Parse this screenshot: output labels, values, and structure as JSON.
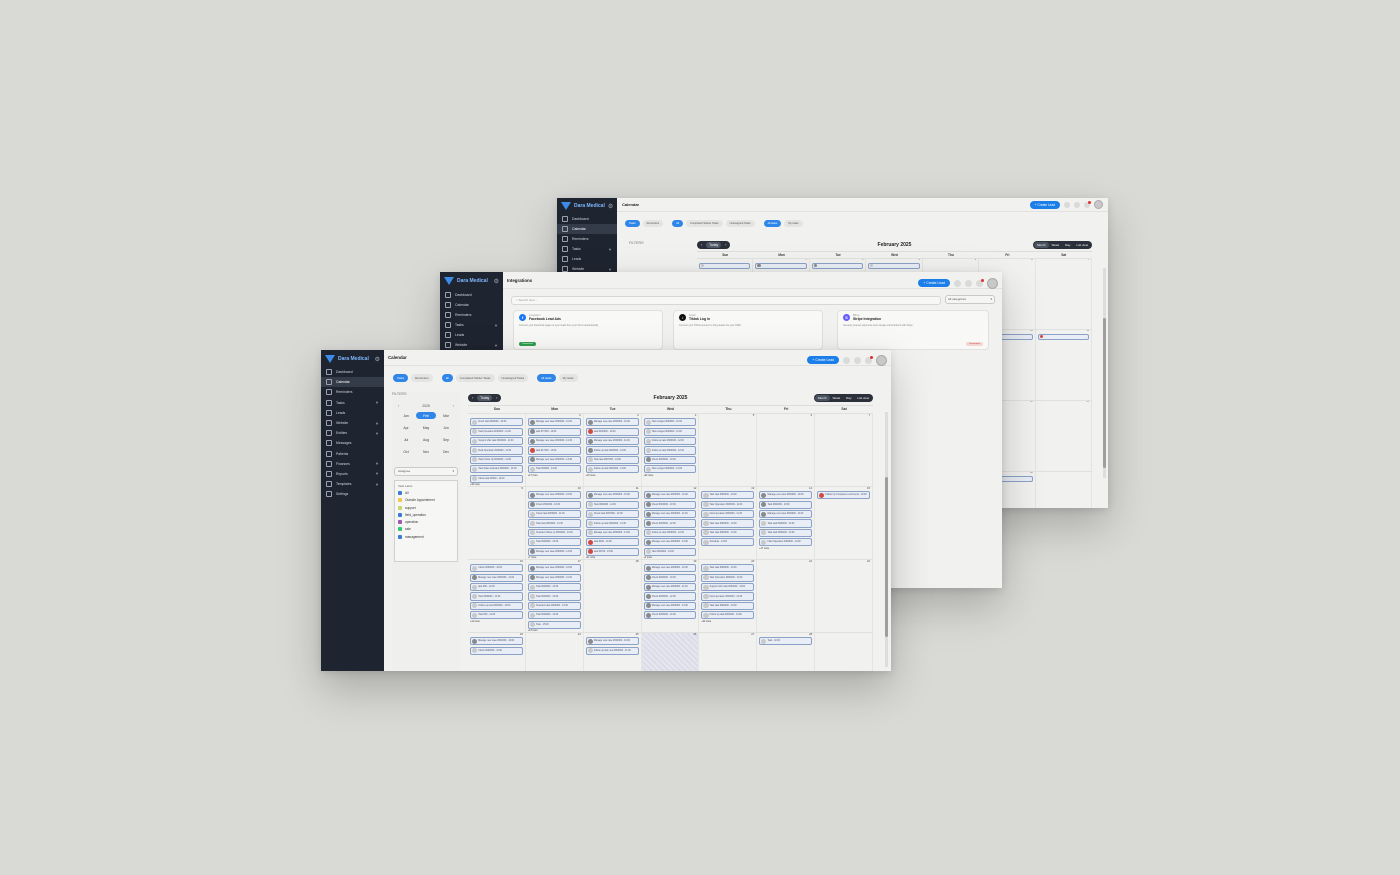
{
  "brand": "Dara Medical",
  "nav": [
    "Dashboard",
    "Calendar",
    "Reminders",
    "Tasks",
    "Leads",
    "Website",
    "Entities",
    "Messages",
    "Patients",
    "Finances",
    "Reports",
    "Templates",
    "Settings"
  ],
  "calendar_page": {
    "title": "Calendar",
    "create_label": "+ Create Lead",
    "chips": [
      "Tasks",
      "Reminders",
      "All",
      "Completed Sticker Tasks",
      "Unassigned Tasks",
      "All tasks",
      "My tasks"
    ],
    "filters_label": "FILTERS",
    "today_label": "Today",
    "month_title": "February 2025",
    "views": [
      "Month",
      "Week",
      "Day",
      "List view"
    ],
    "day_headers": [
      "Sun",
      "Mon",
      "Tue",
      "Wed",
      "Thu",
      "Fri",
      "Sat"
    ],
    "year": "2025",
    "months": [
      "Jan",
      "Feb",
      "Mar",
      "Apr",
      "May",
      "Jun",
      "Jul",
      "Aug",
      "Sep",
      "Oct",
      "Nov",
      "Dec"
    ],
    "assignee_label": "Assignee",
    "task_label_title": "Task Label",
    "task_labels": [
      {
        "name": "All",
        "color": "#3a7bd5"
      },
      {
        "name": "Outside Appointment",
        "color": "#f2c94c"
      },
      {
        "name": "support",
        "color": "#c9d36a"
      },
      {
        "name": "field_operation",
        "color": "#3a7bd5"
      },
      {
        "name": "operation",
        "color": "#9b59b6"
      },
      {
        "name": "sale",
        "color": "#2ecc71"
      },
      {
        "name": "management",
        "color": "#3a7bd5"
      }
    ],
    "weeks": [
      {
        "days": [
          {
            "num": "",
            "events": [
              {
                "t": "Fresh task #000000 - 10:00",
                "a": 0
              },
              {
                "t": "Task Operation #000000 - 11:00",
                "a": 0
              },
              {
                "t": "Support offer task #000000 - 11:30",
                "a": 0
              },
              {
                "t": "Field Operation #000000 - 11:30",
                "a": 0
              },
              {
                "t": "Task Follow Up #000000 - 11:30",
                "a": 0
              },
              {
                "t": "Task Sales Assistant #000000 - 12:00",
                "a": 0
              },
              {
                "t": "Check task #0000 - 12:00",
                "a": 0
              }
            ],
            "more": "+16 more"
          },
          {
            "num": "2",
            "events": [
              {
                "t": "Manage new case #000000 - 11:00",
                "a": 1
              },
              {
                "t": "task #77000 - 12:00",
                "a": 1
              },
              {
                "t": "Manage new case #000000 - 12:30",
                "a": 1
              },
              {
                "t": "task #17000 - 13:00",
                "a": 3
              },
              {
                "t": "Manage new case #000000 - 13:30",
                "a": 1
              },
              {
                "t": "Task #00000 - 14:00",
                "a": 0
              }
            ],
            "more": "+17 more"
          },
          {
            "num": "3",
            "events": [
              {
                "t": "Manage new case #000000 - 10:00",
                "a": 1
              },
              {
                "t": "task #000000 - 10:30",
                "a": 3
              },
              {
                "t": "Manage new case #000000 - 11:00",
                "a": 1
              },
              {
                "t": "Follow up task #000000 - 12:00",
                "a": 1
              },
              {
                "t": "Task task #007000 - 13:00",
                "a": 0
              },
              {
                "t": "Follow up task #000000 - 14:00",
                "a": 0
              }
            ],
            "more": "+15 more"
          },
          {
            "num": "4",
            "events": [
              {
                "t": "Task Lodges #000000 - 10:00",
                "a": 0
              },
              {
                "t": "Task Lodges #000000 - 11:00",
                "a": 0
              },
              {
                "t": "Follow up task #000000 - 12:00",
                "a": 0
              },
              {
                "t": "Follow up task #000000 - 12:30",
                "a": 0
              },
              {
                "t": "Check #000000 - 13:00",
                "a": 1
              },
              {
                "t": "Task Lodges #000000 - 14:00",
                "a": 0
              }
            ],
            "more": "+22 more"
          },
          {
            "num": "5",
            "events": [],
            "more": ""
          },
          {
            "num": "6",
            "events": [],
            "more": ""
          },
          {
            "num": "7",
            "events": [],
            "more": ""
          }
        ]
      },
      {
        "days": [
          {
            "num": "9",
            "events": [],
            "more": ""
          },
          {
            "num": "10",
            "events": [
              {
                "t": "Manage new case #000000 - 10:00",
                "a": 1
              },
              {
                "t": "Check #000000 - 10:30",
                "a": 1
              },
              {
                "t": "Check task #000000 - 11:00",
                "a": 0
              },
              {
                "t": "Task task #000000 - 11:30",
                "a": 0
              },
              {
                "t": "Sussdent follow up #000000 - 12:00",
                "a": 0
              },
              {
                "t": "Task #000000 - 13:00",
                "a": 0
              },
              {
                "t": "Manage new case #000000 - 14:00",
                "a": 1
              }
            ],
            "more": "+7 more"
          },
          {
            "num": "11",
            "events": [
              {
                "t": "Manage new case #000000 - 10:00",
                "a": 1
              },
              {
                "t": "Task #000000 - 11:00",
                "a": 0
              },
              {
                "t": "Check task #007000 - 12:00",
                "a": 0
              },
              {
                "t": "Follow up task #000000 - 12:30",
                "a": 0
              },
              {
                "t": "Manage new case #000000 - 13:00",
                "a": 0
              },
              {
                "t": "task #000 - 14:00",
                "a": 3
              },
              {
                "t": "task #0700 - 15:00",
                "a": 3
              }
            ],
            "more": "+11 more"
          },
          {
            "num": "12",
            "events": [
              {
                "t": "Manage new case #000000 - 10:00",
                "a": 1
              },
              {
                "t": "Check #000000 - 10:30",
                "a": 1
              },
              {
                "t": "Manage new case #000000 - 11:00",
                "a": 1
              },
              {
                "t": "Check #000000 - 12:00",
                "a": 1
              },
              {
                "t": "Follow up task #000000 - 12:30",
                "a": 0
              },
              {
                "t": "Manage new case #000000 - 13:00",
                "a": 1
              },
              {
                "t": "Task #000000 - 14:00",
                "a": 0
              }
            ],
            "more": "+2 more"
          },
          {
            "num": "13",
            "events": [
              {
                "t": "Task task #000000 - 10:00",
                "a": 0
              },
              {
                "t": "Task Operation #000000 - 11:00",
                "a": 0
              },
              {
                "t": "Field operation #000000 - 11:30",
                "a": 0
              },
              {
                "t": "Task task #000000 - 12:00",
                "a": 0
              },
              {
                "t": "Task task #000000 - 13:00",
                "a": 0
              },
              {
                "t": "Schedule - 14:00",
                "a": 0
              }
            ],
            "more": ""
          },
          {
            "num": "14",
            "events": [
              {
                "t": "Manage new case #000000 - 10:00",
                "a": 1
              },
              {
                "t": "Task #000000 - 10:30",
                "a": 1
              },
              {
                "t": "Manage new case #000000 - 11:00",
                "a": 1
              },
              {
                "t": "Task task #000000 - 12:00",
                "a": 0
              },
              {
                "t": "Task task #000000 - 13:00",
                "a": 0
              },
              {
                "t": "Field Operation #000000 - 14:00",
                "a": 0
              }
            ],
            "more": "+17 more"
          },
          {
            "num": "15",
            "events": [
              {
                "t": "Follow Up Complete recommend - 10:00",
                "a": 3
              }
            ],
            "more": ""
          }
        ]
      },
      {
        "days": [
          {
            "num": "16",
            "events": [
              {
                "t": "Check #000000 - 10:00",
                "a": 0
              },
              {
                "t": "Manage new case #000000 - 11:00",
                "a": 1
              },
              {
                "t": "task #00 - 12:00",
                "a": 0
              },
              {
                "t": "Task #000000 - 12:30",
                "a": 0
              },
              {
                "t": "Follow up task #000000 - 13:00",
                "a": 0
              },
              {
                "t": "Task #00 - 14:00",
                "a": 0
              }
            ],
            "more": "+14 more"
          },
          {
            "num": "17",
            "events": [
              {
                "t": "Manage new case #000000 - 10:00",
                "a": 1
              },
              {
                "t": "Manage new case #000000 - 11:00",
                "a": 1
              },
              {
                "t": "Task #000000 - 12:00",
                "a": 0
              },
              {
                "t": "Task #000000 - 13:00",
                "a": 0
              },
              {
                "t": "Sussdent task #000000 - 13:30",
                "a": 0
              },
              {
                "t": "Task #000000 - 14:00",
                "a": 0
              },
              {
                "t": "Task - 15:00",
                "a": 0
              }
            ],
            "more": "+13 more"
          },
          {
            "num": "18",
            "events": [],
            "more": ""
          },
          {
            "num": "19",
            "events": [
              {
                "t": "Manage new case #000000 - 10:00",
                "a": 1
              },
              {
                "t": "Check #000000 - 10:30",
                "a": 1
              },
              {
                "t": "Manage new case #000000 - 11:00",
                "a": 1
              },
              {
                "t": "Check #000000 - 12:00",
                "a": 1
              },
              {
                "t": "Manage new case #000000 - 13:00",
                "a": 1
              },
              {
                "t": "Check #000000 - 14:00",
                "a": 1
              }
            ],
            "more": ""
          },
          {
            "num": "20",
            "events": [
              {
                "t": "Task task #000000 - 10:00",
                "a": 0
              },
              {
                "t": "Task Operation #000000 - 11:00",
                "a": 0
              },
              {
                "t": "Support offer task #000000 - 12:00",
                "a": 0
              },
              {
                "t": "Field operation #000000 - 12:30",
                "a": 0
              },
              {
                "t": "Task task #000000 - 13:00",
                "a": 0
              },
              {
                "t": "Follow up task #000000 - 14:00",
                "a": 0
              }
            ],
            "more": "+22 more"
          },
          {
            "num": "21",
            "events": [],
            "more": ""
          },
          {
            "num": "22",
            "events": [],
            "more": ""
          }
        ]
      },
      {
        "days": [
          {
            "num": "23",
            "events": [
              {
                "t": "Manage new case #000000 - 10:00",
                "a": 1
              },
              {
                "t": "Check #000000 - 11:00",
                "a": 0
              }
            ],
            "more": ""
          },
          {
            "num": "24",
            "events": [],
            "more": ""
          },
          {
            "num": "25",
            "events": [
              {
                "t": "Manage new case #000000 - 10:00",
                "a": 1
              },
              {
                "t": "Follow up task new #000000 - 11:00",
                "a": 0
              }
            ],
            "more": ""
          },
          {
            "num": "26",
            "events": [],
            "more": ""
          },
          {
            "num": "27",
            "events": [],
            "more": ""
          },
          {
            "num": "28",
            "events": [
              {
                "t": "Task - 10:00",
                "a": 0
              }
            ],
            "more": ""
          },
          {
            "num": "",
            "events": [],
            "more": ""
          }
        ]
      }
    ]
  },
  "integrations_page": {
    "title": "Integrations",
    "create_label": "+ Create Lead",
    "search_placeholder": "Search here...",
    "filter_label": "All categories",
    "cards": [
      {
        "category": "Integration",
        "name": "Facebook Lead Ads",
        "desc": "Connect your Facebook pages to sync leads from your forms automatically",
        "badge": "Connected"
      },
      {
        "category": "Social",
        "name": "Tiktok Log in",
        "desc": "Connect your TikTok account to bring leads into your CRM",
        "badge": ""
      },
      {
        "category": "Billing",
        "name": "Stripe Integration",
        "desc": "Securely process payments and manage subscriptions with Stripe",
        "badge": "Disconnect"
      }
    ]
  },
  "colors": {
    "accent": "#1c7ee8",
    "sidebar": "#1f2530",
    "event_border": "#8aa2c8"
  }
}
